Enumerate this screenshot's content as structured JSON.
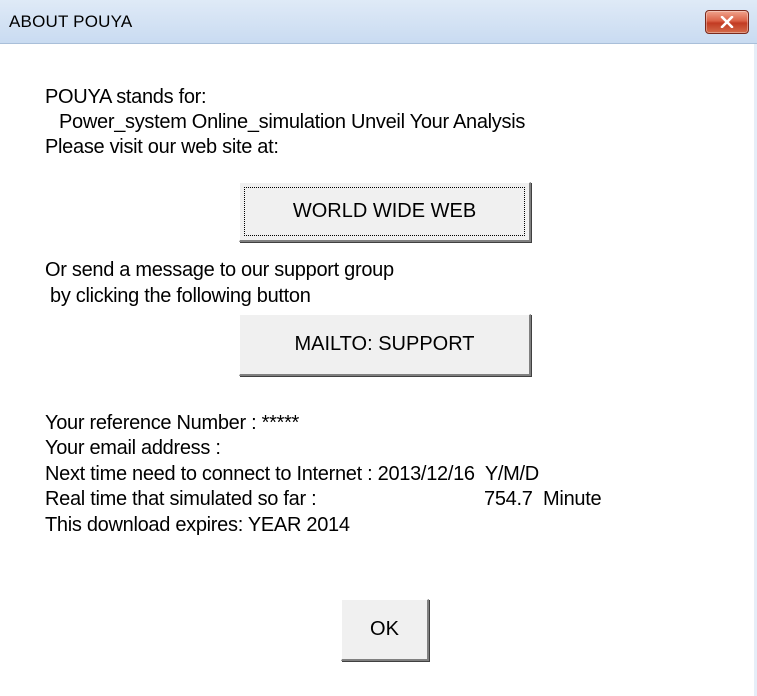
{
  "window": {
    "title": "ABOUT POUYA"
  },
  "about": {
    "line1": "POUYA stands for:",
    "line2": "Power_system Online_simulation Unveil Your Analysis",
    "line3": "Please visit our web site at:",
    "www_button": "WORLD WIDE WEB",
    "line4": "Or send a message to our support group",
    "line5": "by clicking the following button",
    "mailto_button": "MAILTO: SUPPORT",
    "ref_label": "Your reference Number : *****",
    "email_label": "Your email address :",
    "next_connect": "Next time need to connect to Internet : 2013/12/16  Y/M/D",
    "sim_time_label": "Real time that simulated so far :",
    "sim_time_value": "754.7  Minute",
    "expires": "This download expires: YEAR 2014",
    "ok_button": "OK"
  },
  "icons": {
    "close": "close-icon"
  },
  "colors": {
    "titlebar": "#c9dbf1",
    "close_button": "#c23b22",
    "button_face": "#f0f0f0"
  }
}
